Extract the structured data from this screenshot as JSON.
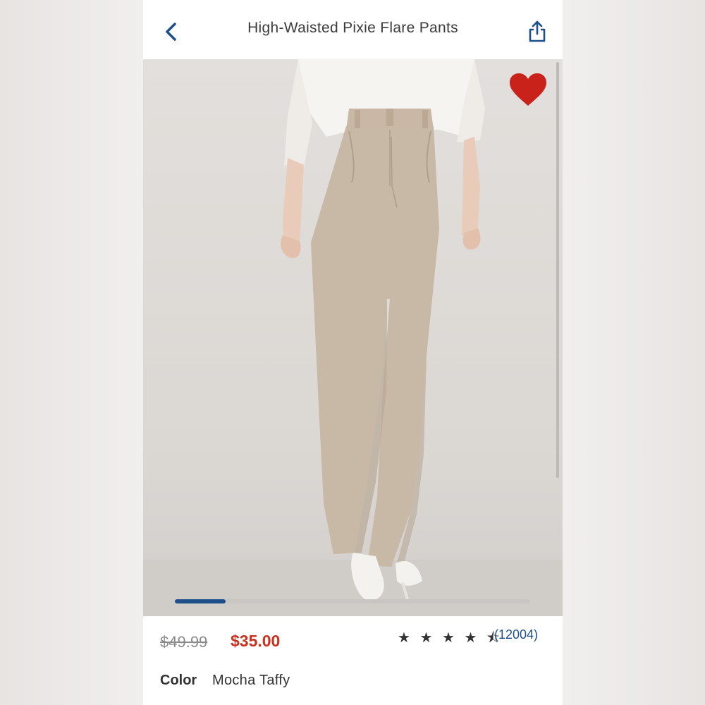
{
  "header": {
    "title": "High-Waisted Pixie Flare Pants",
    "back_icon": "chevron-left-icon",
    "share_icon": "share-icon"
  },
  "gallery": {
    "favorite_icon": "heart-icon",
    "favorite_active": true,
    "image_position": 1,
    "image_count": 7,
    "colors": {
      "pants": "#c8b8a6",
      "shirt": "#f6f4f1",
      "heart": "#c8221a",
      "progress": "#1e4f8a"
    }
  },
  "pricing": {
    "original_price": "$49.99",
    "sale_price": "$35.00"
  },
  "rating": {
    "stars_display": "★ ★ ★ ★ ⯪",
    "value": 4.5,
    "review_count": "(12004)"
  },
  "color": {
    "label": "Color",
    "value": "Mocha Taffy"
  }
}
